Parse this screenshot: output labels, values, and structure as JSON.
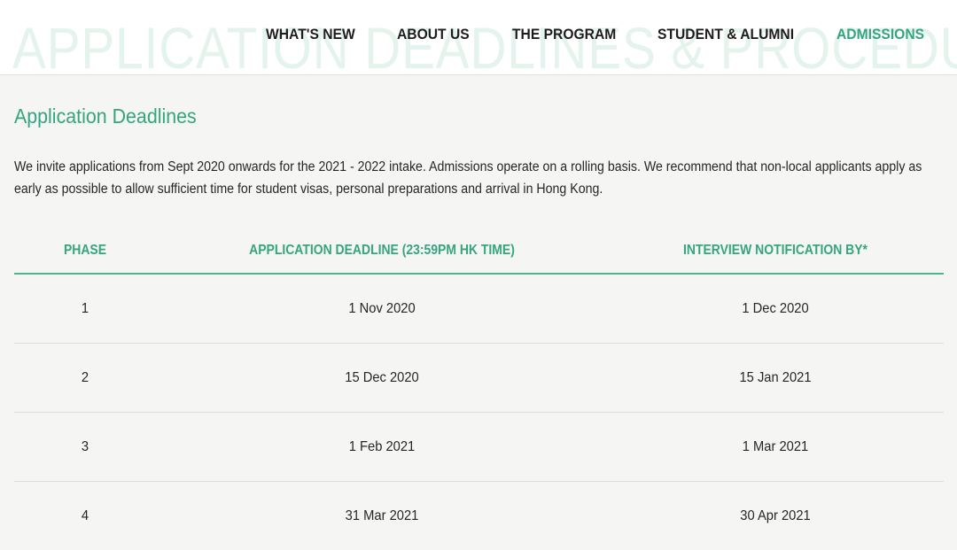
{
  "header": {
    "watermark": "APPLICATION DEADLINES & PROCEDURES",
    "nav": [
      {
        "label": "WHAT'S NEW",
        "active": false
      },
      {
        "label": "ABOUT US",
        "active": false
      },
      {
        "label": "THE PROGRAM",
        "active": false
      },
      {
        "label": "STUDENT & ALUMNI",
        "active": false
      },
      {
        "label": "ADMISSIONS",
        "active": true
      }
    ]
  },
  "main": {
    "title": "Application Deadlines",
    "intro": "We invite applications from Sept 2020 onwards for the 2021 - 2022 intake. Admissions operate on a rolling basis. We recommend that non-local applicants apply as early as possible to allow sufficient time for student visas, personal preparations and arrival in Hong Kong.",
    "table": {
      "headers": [
        "PHASE",
        "APPLICATION DEADLINE (23:59PM HK TIME)",
        "INTERVIEW NOTIFICATION BY*"
      ],
      "rows": [
        [
          "1",
          "1 Nov 2020",
          "1 Dec 2020"
        ],
        [
          "2",
          "15 Dec 2020",
          "15 Jan 2021"
        ],
        [
          "3",
          "1 Feb 2021",
          "1 Mar 2021"
        ],
        [
          "4",
          "31 Mar 2021",
          "30 Apr 2021"
        ]
      ]
    }
  },
  "colors": {
    "accent": "#34a57f",
    "watermark": "#e4f3ec",
    "background": "#f5f5f4",
    "header_background": "#ffffff"
  }
}
